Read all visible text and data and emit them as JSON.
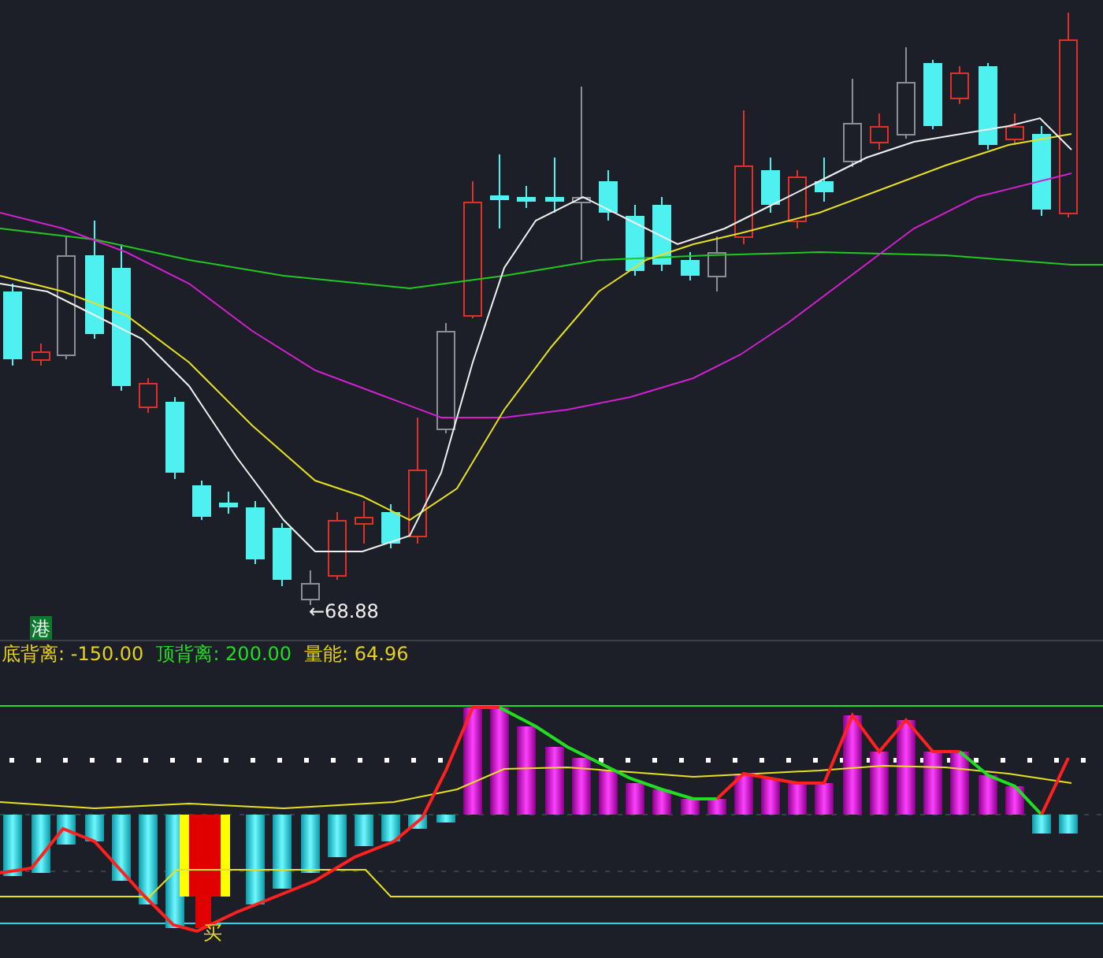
{
  "price_chart": {
    "market_badge": "港",
    "low_price_label": "←68.88"
  },
  "legend": [
    {
      "label": "底背离: -150.00",
      "color": "#e6d21c"
    },
    {
      "label": "顶背离: 200.00",
      "color": "#22dd22"
    },
    {
      "label": "量能: 64.96",
      "color": "#e6d21c"
    }
  ],
  "indicator_chart": {
    "buy_signal": "买"
  }
}
